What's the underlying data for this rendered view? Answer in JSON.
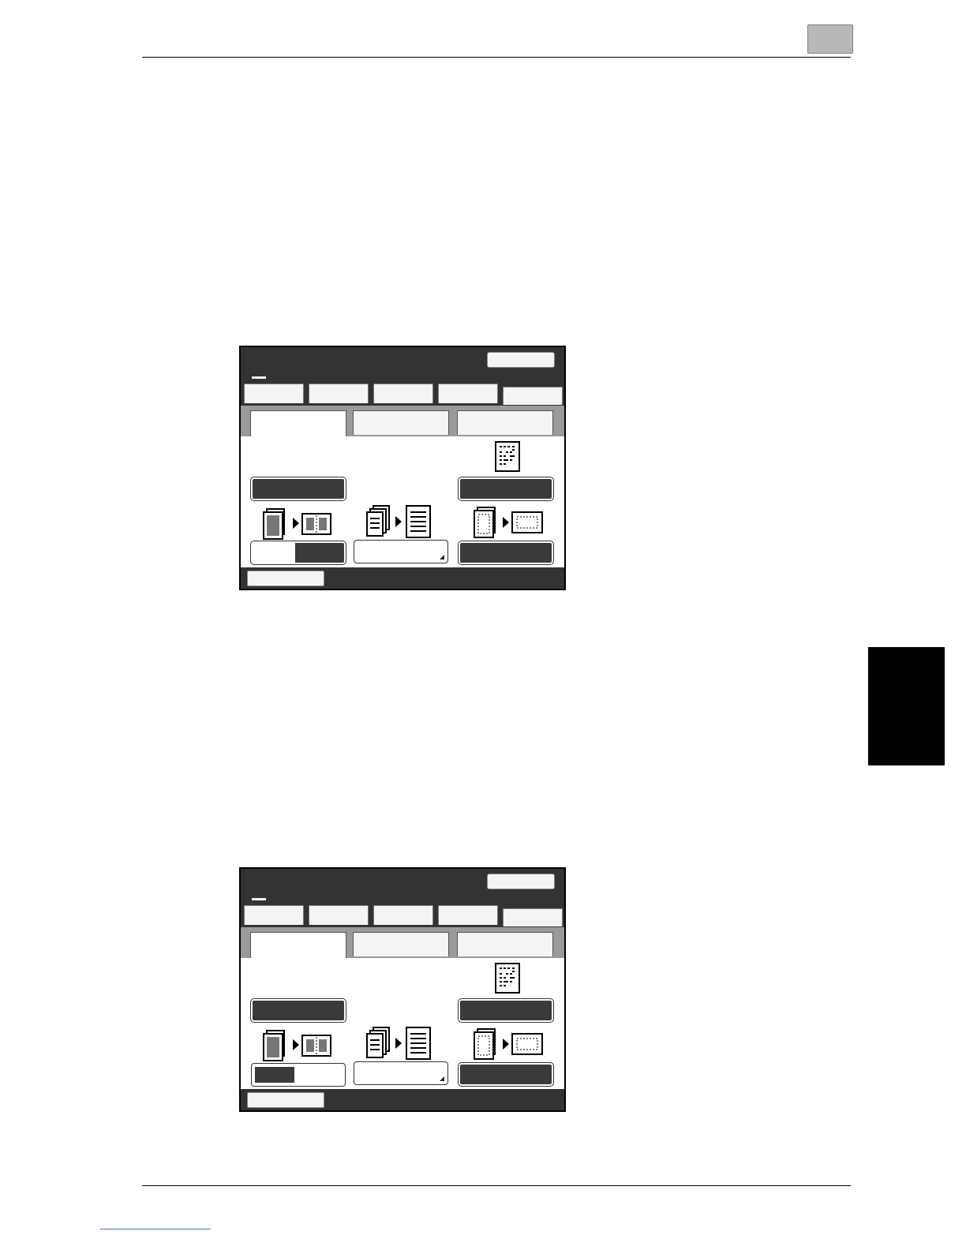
{
  "page": {
    "chapter_tab_color": "#b8b8b8",
    "side_tab_color": "#000000"
  },
  "screens": [
    {
      "name": "screen-1",
      "functions": {
        "left_button_state": "left-half-selected",
        "right_button_state": "selected"
      }
    },
    {
      "name": "screen-2",
      "functions": {
        "left_button_state": "left-segment-filled",
        "right_button_state": "selected"
      }
    }
  ],
  "icons": [
    "page-single-icon",
    "arrow-right-icon",
    "book-spread-icon",
    "stacked-pages-icon",
    "text-page-icon",
    "page-dotted-icon",
    "frame-erase-icon",
    "text-document-icon"
  ]
}
